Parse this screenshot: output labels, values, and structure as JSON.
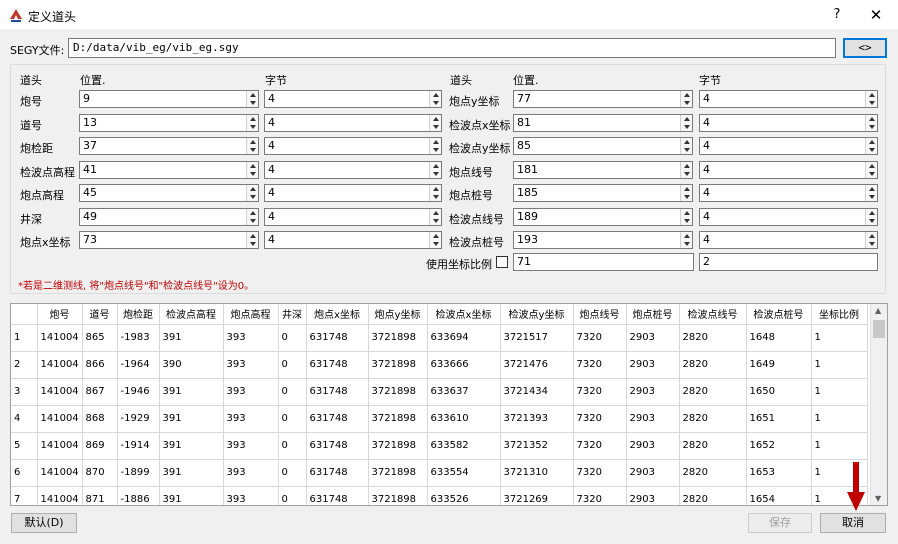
{
  "window": {
    "title": "定义道头",
    "help": "?",
    "close": "✕"
  },
  "segy": {
    "label": "SEGY文件:",
    "path": "D:/data/vib_eg/vib_eg.sgy",
    "browse_label": "<>"
  },
  "headers": {
    "left_title": "道头",
    "left_pos": "位置.",
    "left_bytes": "字节",
    "right_title": "道头",
    "right_pos": "位置.",
    "right_bytes": "字节"
  },
  "left_rows": [
    {
      "label": "炮号",
      "pos": "9",
      "bytes": "4"
    },
    {
      "label": "道号",
      "pos": "13",
      "bytes": "4"
    },
    {
      "label": "炮检距",
      "pos": "37",
      "bytes": "4"
    },
    {
      "label": "检波点高程",
      "pos": "41",
      "bytes": "4"
    },
    {
      "label": "炮点高程",
      "pos": "45",
      "bytes": "4"
    },
    {
      "label": "井深",
      "pos": "49",
      "bytes": "4"
    },
    {
      "label": "炮点x坐标",
      "pos": "73",
      "bytes": "4"
    }
  ],
  "right_rows": [
    {
      "label": "炮点y坐标",
      "pos": "77",
      "bytes": "4"
    },
    {
      "label": "检波点x坐标",
      "pos": "81",
      "bytes": "4"
    },
    {
      "label": "检波点y坐标",
      "pos": "85",
      "bytes": "4"
    },
    {
      "label": "炮点线号",
      "pos": "181",
      "bytes": "4"
    },
    {
      "label": "炮点桩号",
      "pos": "185",
      "bytes": "4"
    },
    {
      "label": "检波点线号",
      "pos": "189",
      "bytes": "4"
    },
    {
      "label": "检波点桩号",
      "pos": "193",
      "bytes": "4"
    }
  ],
  "scale": {
    "label": "使用坐标比例",
    "checked": false,
    "pos": "71",
    "bytes": "2"
  },
  "note": "*若是二维测线, 将\"炮点线号\"和\"检波点线号\"设为0。",
  "table": {
    "columns": [
      "炮号",
      "道号",
      "炮检距",
      "检波点高程",
      "炮点高程",
      "井深",
      "炮点x坐标",
      "炮点y坐标",
      "检波点x坐标",
      "检波点y坐标",
      "炮点线号",
      "炮点桩号",
      "检波点线号",
      "检波点桩号",
      "坐标比例"
    ],
    "rows": [
      {
        "n": "1",
        "cells": [
          "141004",
          "865",
          "-1983",
          "391",
          "393",
          "0",
          "631748",
          "3721898",
          "633694",
          "3721517",
          "7320",
          "2903",
          "2820",
          "1648",
          "1"
        ]
      },
      {
        "n": "2",
        "cells": [
          "141004",
          "866",
          "-1964",
          "390",
          "393",
          "0",
          "631748",
          "3721898",
          "633666",
          "3721476",
          "7320",
          "2903",
          "2820",
          "1649",
          "1"
        ]
      },
      {
        "n": "3",
        "cells": [
          "141004",
          "867",
          "-1946",
          "391",
          "393",
          "0",
          "631748",
          "3721898",
          "633637",
          "3721434",
          "7320",
          "2903",
          "2820",
          "1650",
          "1"
        ]
      },
      {
        "n": "4",
        "cells": [
          "141004",
          "868",
          "-1929",
          "391",
          "393",
          "0",
          "631748",
          "3721898",
          "633610",
          "3721393",
          "7320",
          "2903",
          "2820",
          "1651",
          "1"
        ]
      },
      {
        "n": "5",
        "cells": [
          "141004",
          "869",
          "-1914",
          "391",
          "393",
          "0",
          "631748",
          "3721898",
          "633582",
          "3721352",
          "7320",
          "2903",
          "2820",
          "1652",
          "1"
        ]
      },
      {
        "n": "6",
        "cells": [
          "141004",
          "870",
          "-1899",
          "391",
          "393",
          "0",
          "631748",
          "3721898",
          "633554",
          "3721310",
          "7320",
          "2903",
          "2820",
          "1653",
          "1"
        ]
      },
      {
        "n": "7",
        "cells": [
          "141004",
          "871",
          "-1886",
          "391",
          "393",
          "0",
          "631748",
          "3721898",
          "633526",
          "3721269",
          "7320",
          "2903",
          "2820",
          "1654",
          "1"
        ]
      }
    ]
  },
  "buttons": {
    "default": "默认(D)",
    "save": "保存",
    "cancel": "取消"
  },
  "colors": {
    "note": "#c00000",
    "arrow": "#c00000",
    "focus": "#0078d7"
  }
}
